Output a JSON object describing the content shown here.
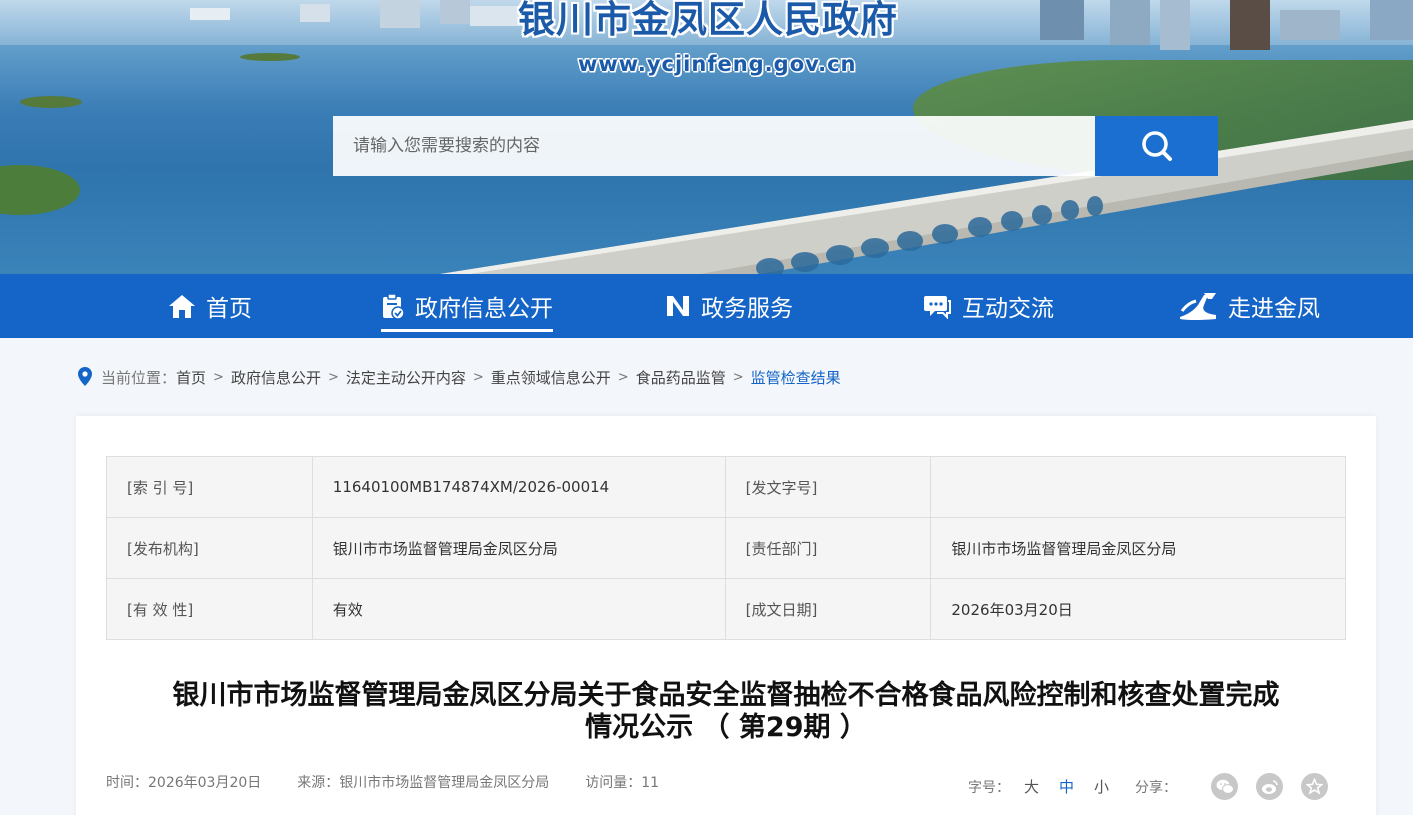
{
  "header": {
    "site_title": "银川市金凤区人民政府",
    "site_url": "www.ycjinfeng.gov.cn"
  },
  "search": {
    "placeholder": "请输入您需要搜索的内容",
    "icon": "search-icon"
  },
  "nav": {
    "items": [
      {
        "label": "首页",
        "icon": "home-icon"
      },
      {
        "label": "政府信息公开",
        "icon": "document-check-icon",
        "active": true
      },
      {
        "label": "政务服务",
        "icon": "service-logo-icon"
      },
      {
        "label": "互动交流",
        "icon": "chat-icon"
      },
      {
        "label": "走进金凤",
        "icon": "landmark-icon"
      }
    ]
  },
  "breadcrumb": {
    "label": "当前位置：",
    "items": [
      "首页",
      "政府信息公开",
      "法定主动公开内容",
      "重点领域信息公开",
      "食品药品监管",
      "监管检查结果"
    ]
  },
  "meta": {
    "rows": [
      {
        "k1": "[索 引 号]",
        "v1": "11640100MB174874XM/2026-00014",
        "k2": "[发文字号]",
        "v2": ""
      },
      {
        "k1": "[发布机构]",
        "v1": "银川市市场监督管理局金凤区分局",
        "k2": "[责任部门]",
        "v2": "银川市市场监督管理局金凤区分局"
      },
      {
        "k1": "[有 效 性]",
        "v1": "有效",
        "k2": "[成文日期]",
        "v2": "2026年03月20日"
      }
    ]
  },
  "article": {
    "title_line1": "银川市市场监督管理局金凤区分局关于食品安全监督抽检不合格食品风险控制和核查处置完成",
    "title_line2": "情况公示 （ 第29期 ）",
    "time": "时间：2026年03月20日",
    "source": "来源：银川市市场监督管理局金凤区分局",
    "views": "访问量：11"
  },
  "tools": {
    "font_label": "字号：",
    "sizes": [
      "大",
      "中",
      "小"
    ],
    "active_size": "中",
    "share_label": "分享：",
    "share_icons": [
      "wechat-icon",
      "weibo-icon",
      "favorite-icon"
    ]
  },
  "colors": {
    "nav_bg": "#1565c8",
    "accent": "#1565c8",
    "search_btn": "#1b6fd0"
  }
}
